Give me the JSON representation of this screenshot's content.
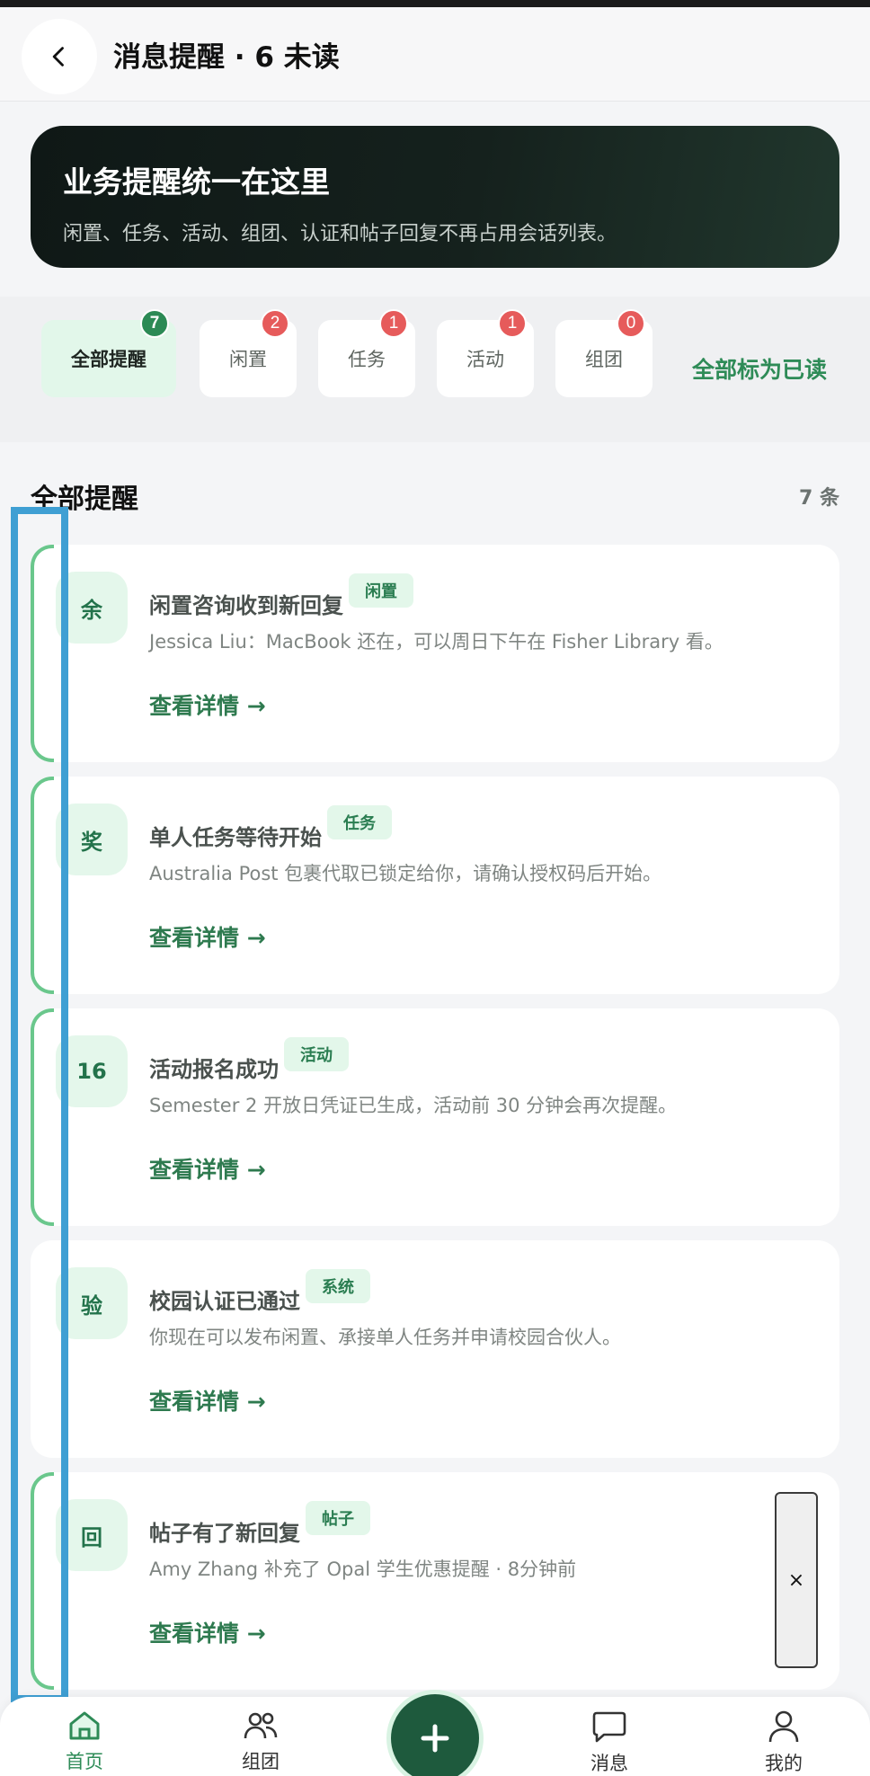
{
  "header": {
    "title": "消息提醒 · 6 未读"
  },
  "banner": {
    "title": "业务提醒统一在这里",
    "subtitle": "闲置、任务、活动、组团、认证和帖子回复不再占用会话列表。"
  },
  "filters": [
    {
      "label": "全部提醒",
      "count": "7"
    },
    {
      "label": "闲置",
      "count": "2"
    },
    {
      "label": "任务",
      "count": "1"
    },
    {
      "label": "活动",
      "count": "1"
    },
    {
      "label": "组团",
      "count": "0"
    }
  ],
  "mark_all_read": "全部标为已读",
  "section": {
    "title": "全部提醒",
    "count": "7 条"
  },
  "cards": [
    {
      "avatar": "余",
      "title": "闲置咨询收到新回复",
      "tag": "闲置",
      "desc": "Jessica Liu：MacBook 还在，可以周日下午在 Fisher Library 看。",
      "link": "查看详情 →"
    },
    {
      "avatar": "奖",
      "title": "单人任务等待开始",
      "tag": "任务",
      "desc": "Australia Post 包裹代取已锁定给你，请确认授权码后开始。",
      "link": "查看详情 →"
    },
    {
      "avatar": "16",
      "title": "活动报名成功",
      "tag": "活动",
      "desc": "Semester 2 开放日凭证已生成，活动前 30 分钟会再次提醒。",
      "link": "查看详情 →"
    },
    {
      "avatar": "验",
      "title": "校园认证已通过",
      "tag": "系统",
      "desc": "你现在可以发布闲置、承接单人任务并申请校园合伙人。",
      "link": "查看详情 →"
    },
    {
      "avatar": "回",
      "title": "帖子有了新回复",
      "tag": "帖子",
      "desc": "Amy Zhang 补充了 Opal 学生优惠提醒 · 8分钟前",
      "link": "查看详情 →"
    }
  ],
  "float_close": "×",
  "nav": {
    "home": "首页",
    "group": "组团",
    "messages": "消息",
    "me": "我的"
  },
  "colors": {
    "accent": "#2e8b57",
    "fab": "#1e5a3d",
    "badge_red": "#e65b5b",
    "selection": "#3f9fd3"
  }
}
